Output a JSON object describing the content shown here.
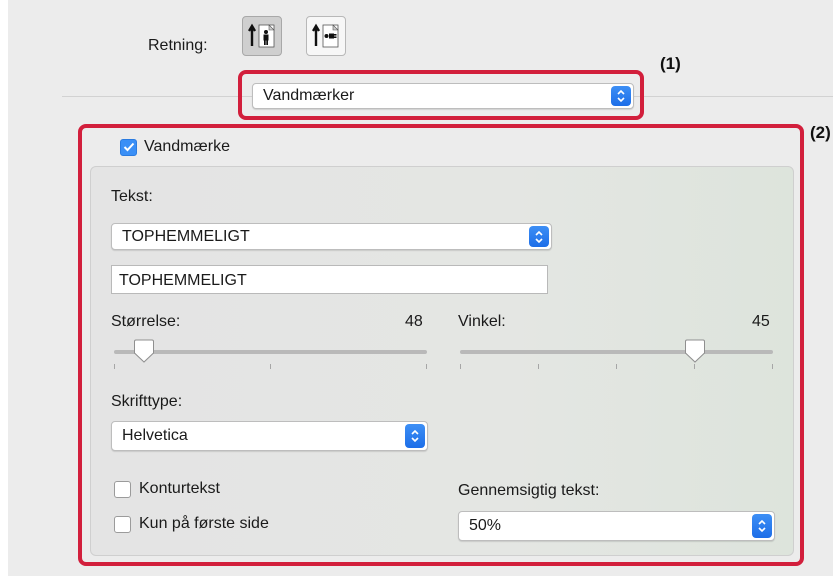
{
  "orientation": {
    "label": "Retning:",
    "options": [
      {
        "name": "portrait",
        "selected": true
      },
      {
        "name": "landscape",
        "selected": false
      }
    ]
  },
  "panel_selector": {
    "value": "Vandmærker",
    "callout": "(1)"
  },
  "watermark": {
    "callout": "(2)",
    "checkbox_label": "Vandmærke",
    "checked": true,
    "text_label": "Tekst:",
    "text_select_value": "TOPHEMMELIGT",
    "text_field_value": "TOPHEMMELIGT",
    "size": {
      "label": "Størrelse:",
      "value": "48",
      "level": 48,
      "range": [
        0,
        500
      ],
      "tick_count": 3
    },
    "angle": {
      "label": "Vinkel:",
      "value": "45",
      "level": 45,
      "range": [
        -90,
        90
      ],
      "tick_count": 5
    },
    "font_label": "Skrifttype:",
    "font_value": "Helvetica",
    "outline_label": "Konturtekst",
    "outline_checked": false,
    "first_page_label": "Kun på første side",
    "first_page_checked": false,
    "transparency_label": "Gennemsigtig tekst:",
    "transparency_value": "50%"
  },
  "colors": {
    "callout": "#d21f3c",
    "accent": "#3a8ff6"
  }
}
